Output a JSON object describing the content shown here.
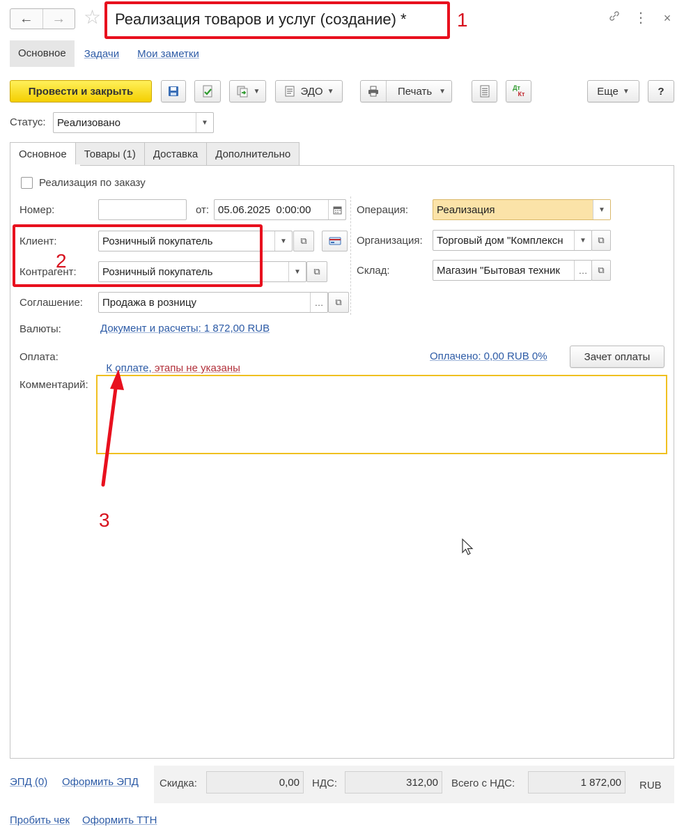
{
  "window": {
    "title": "Реализация товаров и услуг (создание) *",
    "annotations": [
      "1",
      "2",
      "3"
    ]
  },
  "subtabs": [
    "Основное",
    "Задачи",
    "Мои заметки"
  ],
  "toolbar": {
    "post_close": "Провести и закрыть",
    "edo": "ЭДО",
    "print": "Печать",
    "more": "Еще",
    "help": "?",
    "dtkt_top": "Дт",
    "dtkt_bottom": "Кт"
  },
  "status": {
    "label": "Статус:",
    "value": "Реализовано"
  },
  "tabs": [
    "Основное",
    "Товары (1)",
    "Доставка",
    "Дополнительно"
  ],
  "form": {
    "by_order": "Реализация по заказу",
    "number_label": "Номер:",
    "number_value": "",
    "date_from_label": "от:",
    "date_value": "05.06.2025  0:00:00",
    "client_label": "Клиент:",
    "client_value": "Розничный покупатель",
    "counterparty_label": "Контрагент:",
    "counterparty_value": "Розничный покупатель",
    "agreement_label": "Соглашение:",
    "agreement_value": "Продажа в розницу",
    "currency_label": "Валюты:",
    "currency_link": "Документ и расчеты: 1 872,00 RUB",
    "payment_label": "Оплата:",
    "payment_link_blue": "К оплате,",
    "payment_link_red": " этапы не указаны",
    "paid_link": "Оплачено: 0,00 RUB 0%",
    "offset_button": "Зачет оплаты",
    "comment_label": "Комментарий:",
    "comment_value": "",
    "operation_label": "Операция:",
    "operation_value": "Реализация",
    "organization_label": "Организация:",
    "organization_value": "Торговый дом \"Комплексн",
    "warehouse_label": "Склад:",
    "warehouse_value": "Магазин \"Бытовая техник"
  },
  "footer": {
    "epd": "ЭПД (0)",
    "make_epd": "Оформить ЭПД",
    "discount_label": "Скидка:",
    "discount_value": "0,00",
    "vat_label": "НДС:",
    "vat_value": "312,00",
    "total_label": "Всего с НДС:",
    "total_value": "1 872,00",
    "currency": "RUB",
    "receipt": "Пробить чек",
    "ttn": "Оформить ТТН"
  },
  "colors": {
    "annotation_red": "#e8101e",
    "primary_yellow": "#f4cf00",
    "link_blue": "#2d5ba6",
    "highlight_field": "#fbe3a8",
    "comment_border": "#f0c020"
  }
}
